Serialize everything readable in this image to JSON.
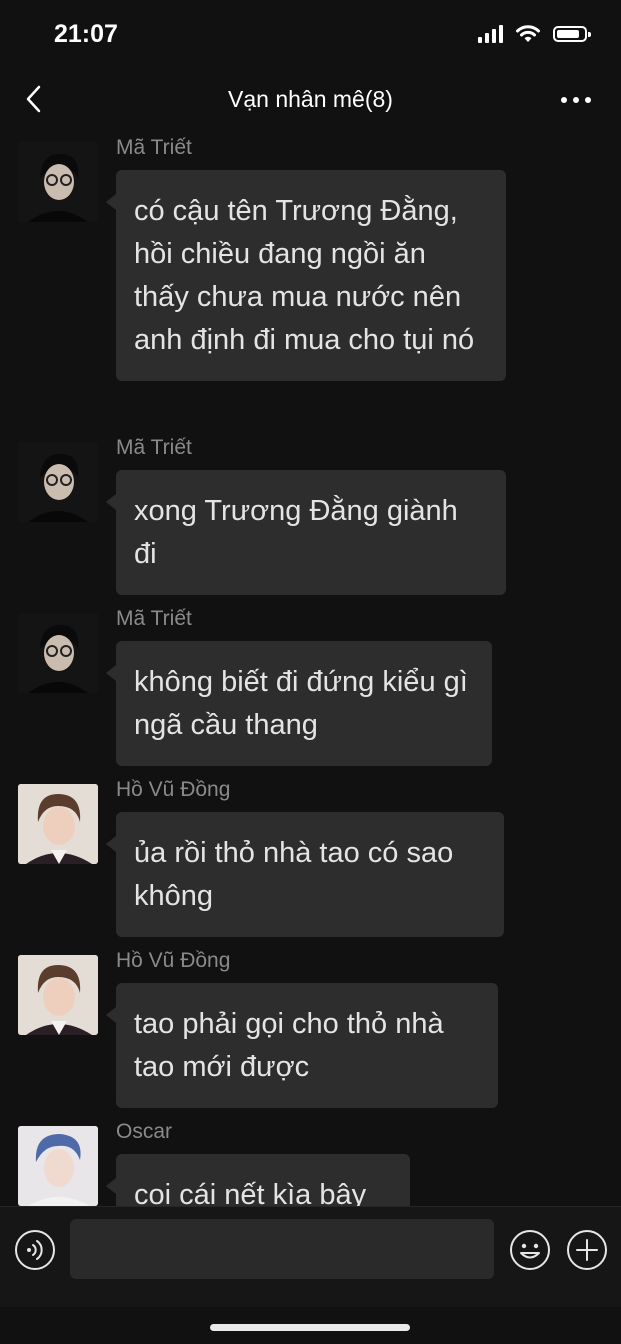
{
  "status_bar": {
    "time": "21:07"
  },
  "header": {
    "title": "Vạn nhân mê(8)",
    "back_icon": "chevron-left-icon",
    "more_icon": "more-dots-icon"
  },
  "messages": [
    {
      "sender": "Mã Triết",
      "text": "có cậu tên Trương Đằng, hồi chiều đang ngồi ăn thấy chưa mua nước nên anh định đi mua cho tụi nó"
    },
    {
      "sender": "Mã Triết",
      "text": "xong Trương Đằng giành đi"
    },
    {
      "sender": "Mã Triết",
      "text": "không biết đi đứng kiểu gì ngã cầu thang"
    },
    {
      "sender": "Hồ Vũ Đồng",
      "text": "ủa rồi thỏ nhà tao có sao không"
    },
    {
      "sender": "Hồ Vũ Đồng",
      "text": "tao phải gọi cho thỏ nhà tao mới được"
    },
    {
      "sender": "Oscar",
      "text": "coi cái nết kìa bây"
    }
  ],
  "input_bar": {
    "placeholder": ""
  },
  "colors": {
    "background": "#111111",
    "bubble": "#2d2d2d",
    "sender": "#8a8a8a"
  }
}
